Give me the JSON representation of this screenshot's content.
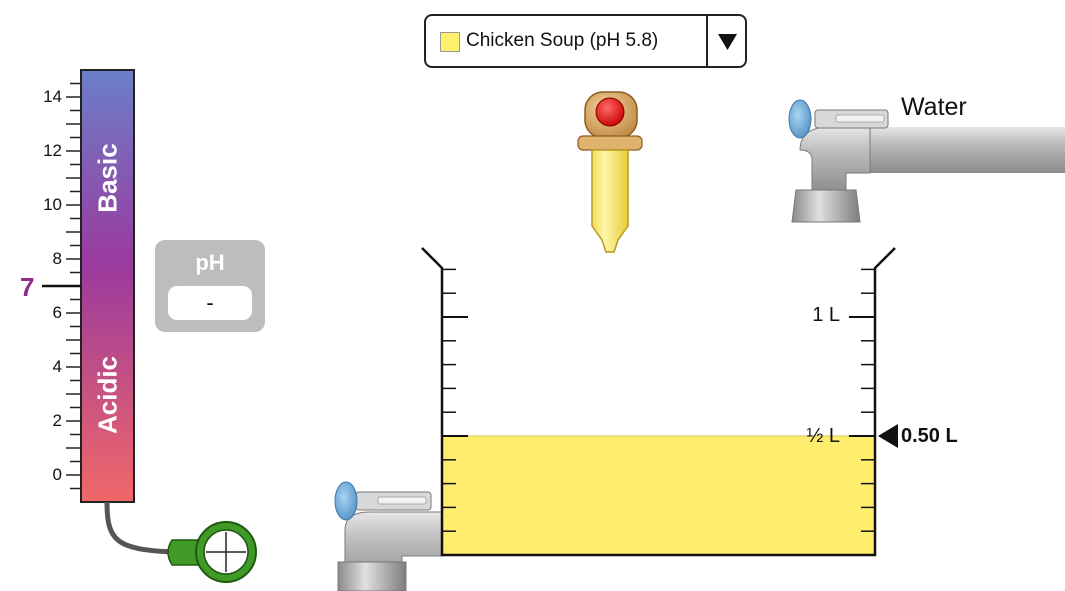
{
  "solute_selector": {
    "selected_label": "Chicken Soup (pH 5.8)",
    "swatch_color": "#FFF06B",
    "arrow_icon": "triangle-down"
  },
  "ph_scale": {
    "tick_labels": [
      "14",
      "12",
      "10",
      "8",
      "6",
      "4",
      "2",
      "0"
    ],
    "basic_label": "Basic",
    "acidic_label": "Acidic",
    "neutral_marker": "7",
    "neutral_color": "#8E2C8E",
    "gradient_colors": [
      "#6B7FC8",
      "#9A3A9E",
      "#F06868"
    ]
  },
  "ph_meter": {
    "title": "pH",
    "value": "-"
  },
  "water_faucet": {
    "label": "Water"
  },
  "beaker": {
    "label_1l": "1 L",
    "label_half_l": "½ L",
    "volume_readout": "0.50 L",
    "volume_liters": 0.5,
    "capacity_liters": 1.2,
    "liquid_color": "#FFEE6E"
  }
}
